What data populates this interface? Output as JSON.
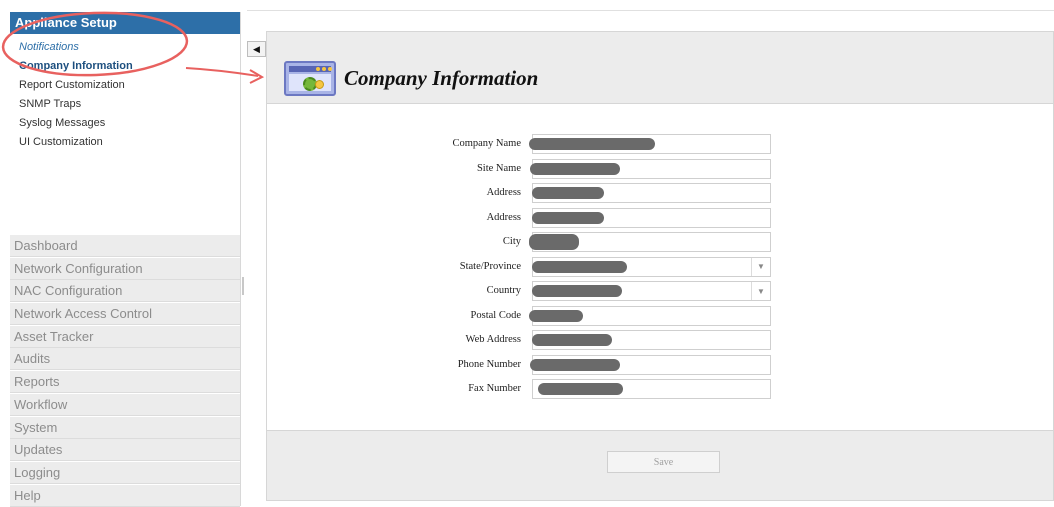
{
  "sidebar": {
    "header": "Appliance Setup",
    "sub_items": [
      {
        "label": "Notifications",
        "style": "italic"
      },
      {
        "label": "Company Information",
        "style": "active"
      },
      {
        "label": "Report Customization",
        "style": "normal"
      },
      {
        "label": "SNMP Traps",
        "style": "normal"
      },
      {
        "label": "Syslog Messages",
        "style": "normal"
      },
      {
        "label": "UI Customization",
        "style": "normal"
      }
    ],
    "sections": [
      "Dashboard",
      "Network Configuration",
      "NAC Configuration",
      "Network Access Control",
      "Asset Tracker",
      "Audits",
      "Reports",
      "Workflow",
      "System",
      "Updates",
      "Logging",
      "Help"
    ]
  },
  "toggle": {
    "icon": "collapse-left-icon",
    "glyph": "◀"
  },
  "page": {
    "title": "Company Information",
    "icon": "settings-window-icon"
  },
  "form": {
    "fields": [
      {
        "label": "Company Name",
        "kind": "text",
        "value_redacted": true
      },
      {
        "label": "Site Name",
        "kind": "text",
        "value_redacted": true
      },
      {
        "label": "Address",
        "kind": "text",
        "value_redacted": true
      },
      {
        "label": "Address",
        "kind": "text",
        "value_redacted": true
      },
      {
        "label": "City",
        "kind": "text",
        "value_redacted": true
      },
      {
        "label": "State/Province",
        "kind": "select",
        "value_redacted": true
      },
      {
        "label": "Country",
        "kind": "select",
        "value_redacted": true
      },
      {
        "label": "Postal Code",
        "kind": "text",
        "value_redacted": true
      },
      {
        "label": "Web Address",
        "kind": "text",
        "value_redacted": true
      },
      {
        "label": "Phone Number",
        "kind": "text",
        "value_redacted": true
      },
      {
        "label": "Fax Number",
        "kind": "text",
        "value_redacted": true
      }
    ],
    "save_label": "Save"
  },
  "colors": {
    "sidebar_header": "#2d6fa8",
    "active_item": "#1d4f7f",
    "annotation": "#e8615f"
  }
}
